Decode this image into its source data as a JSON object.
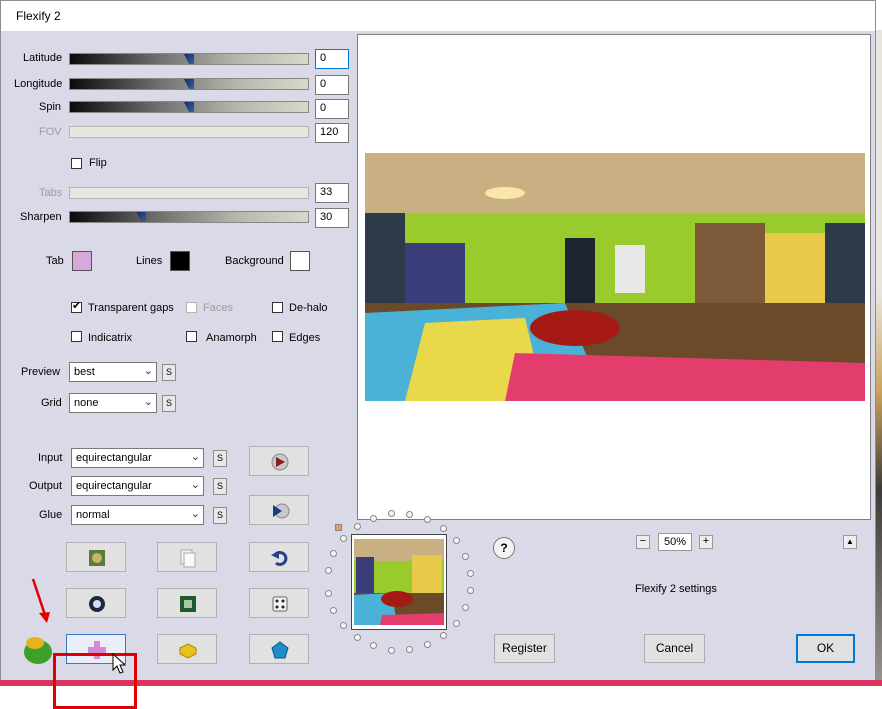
{
  "window": {
    "title": "Flexify 2"
  },
  "sliders": [
    {
      "id": "latitude",
      "label": "Latitude",
      "value": "0",
      "position": 0.5,
      "enabled": true
    },
    {
      "id": "longitude",
      "label": "Longitude",
      "value": "0",
      "position": 0.5,
      "enabled": true
    },
    {
      "id": "spin",
      "label": "Spin",
      "value": "0",
      "position": 0.5,
      "enabled": true
    },
    {
      "id": "fov",
      "label": "FOV",
      "value": "120",
      "enabled": false
    },
    {
      "id": "tabs",
      "label": "Tabs",
      "value": "33",
      "enabled": false
    },
    {
      "id": "sharpen",
      "label": "Sharpen",
      "value": "30",
      "position": 0.3,
      "enabled": true
    }
  ],
  "flip": {
    "label": "Flip",
    "checked": false
  },
  "colors": {
    "tab": {
      "label": "Tab",
      "value": "#d8a8dc"
    },
    "lines": {
      "label": "Lines",
      "value": "#000000"
    },
    "background": {
      "label": "Background",
      "value": "#ffffff"
    }
  },
  "options": {
    "transparent_gaps": {
      "label": "Transparent gaps",
      "checked": true
    },
    "faces": {
      "label": "Faces",
      "checked": false,
      "enabled": false
    },
    "de_halo": {
      "label": "De-halo",
      "checked": false
    },
    "indicatrix": {
      "label": "Indicatrix",
      "checked": false
    },
    "anamorph": {
      "label": "Anamorph",
      "checked": false
    },
    "edges": {
      "label": "Edges",
      "checked": false
    }
  },
  "preview_select": {
    "label": "Preview",
    "value": "best"
  },
  "grid_select": {
    "label": "Grid",
    "value": "none"
  },
  "s_label": "S",
  "input_select": {
    "label": "Input",
    "value": "equirectangular"
  },
  "output_select": {
    "label": "Output",
    "value": "equirectangular"
  },
  "glue_select": {
    "label": "Glue",
    "value": "normal"
  },
  "zoom": {
    "minus": "−",
    "value": "50%",
    "plus": "+"
  },
  "help_label": "?",
  "scroll_up_label": "▲",
  "settings_text": "Flexify 2 settings",
  "buttons": {
    "register": "Register",
    "cancel": "Cancel",
    "ok": "OK"
  },
  "accent_colors": {
    "highlight": "#e00000",
    "focus": "#0078d7"
  }
}
